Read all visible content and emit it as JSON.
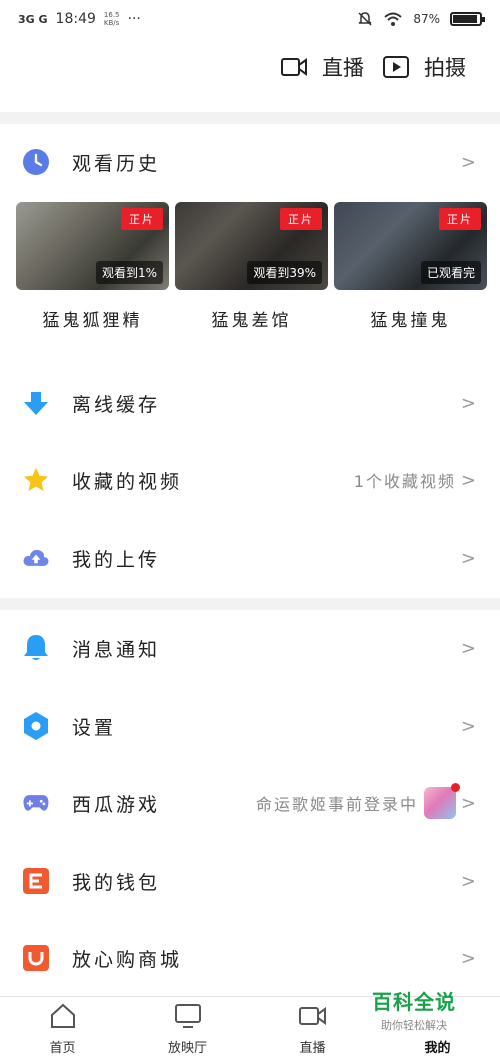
{
  "status_bar": {
    "signal": "3G G",
    "time": "18:49",
    "speed_value": "16.5",
    "speed_unit": "KB/s",
    "more": "···",
    "battery": "87%",
    "battery_level": 0.87
  },
  "top_actions": {
    "live_label": "直播",
    "shoot_label": "拍摄"
  },
  "history": {
    "title": "观看历史",
    "cards": [
      {
        "title": "猛鬼狐狸精",
        "badge": "正片",
        "progress": "观看到1%"
      },
      {
        "title": "猛鬼差馆",
        "badge": "正片",
        "progress": "观看到39%"
      },
      {
        "title": "猛鬼撞鬼",
        "badge": "正片",
        "progress": "已观看完"
      }
    ]
  },
  "menu": {
    "offline": "离线缓存",
    "favorites": "收藏的视频",
    "favorites_count": "1个收藏视频",
    "upload": "我的上传",
    "messages": "消息通知",
    "settings": "设置",
    "games": "西瓜游戏",
    "games_promo": "命运歌姬事前登录中",
    "wallet": "我的钱包",
    "mall": "放心购商城"
  },
  "tabs": {
    "home": "首页",
    "theater": "放映厅",
    "live": "直播",
    "mine": "我的"
  },
  "watermark": {
    "title": "百科全说",
    "subtitle": "助你轻松解决"
  },
  "colors": {
    "history_icon": "#5b7be6",
    "offline_icon": "#2a9ef5",
    "star_icon": "#f7c316",
    "upload_icon": "#6f86e8",
    "bell_icon": "#2a9ef5",
    "settings_icon": "#2a9ef5",
    "game_icon": "#6f7fe6",
    "wallet_icon": "#f05a30",
    "mall_icon": "#f05a30",
    "badge_red": "#e8202a"
  }
}
